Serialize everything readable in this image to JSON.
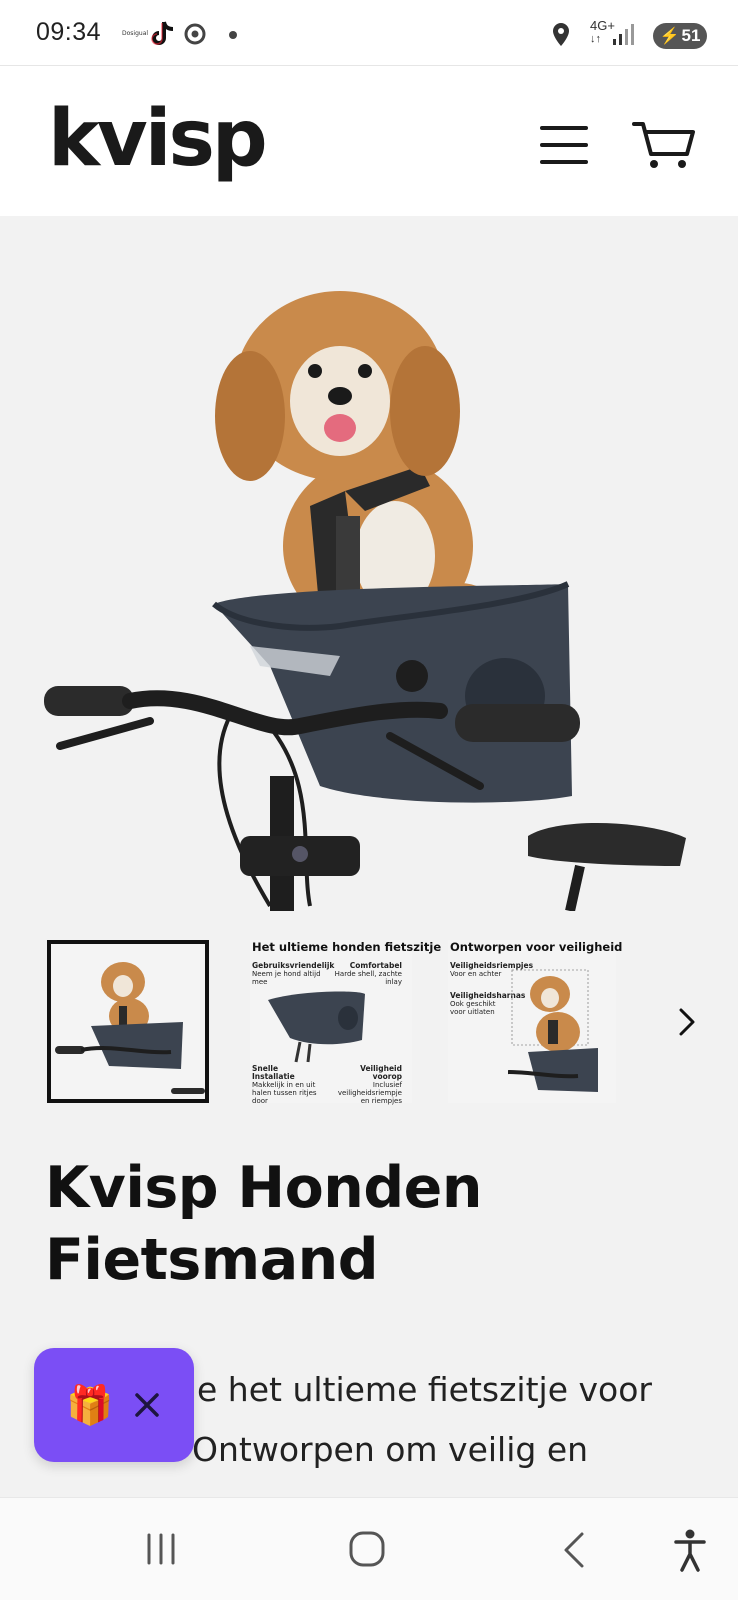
{
  "status_bar": {
    "time": "09:34",
    "tiny_label": "Dosigual",
    "network": "4G+",
    "battery": "51"
  },
  "header": {
    "logo": "kvisp",
    "menu_icon": "hamburger-menu-icon",
    "cart_icon": "shopping-cart-icon"
  },
  "gallery": {
    "thumbnails": [
      {
        "name": "product-photo"
      },
      {
        "title": "Het ultieme honden fietszitje",
        "features": [
          {
            "label": "Gebruiksvriendelijk",
            "text": "Neem je hond altijd mee"
          },
          {
            "label": "Comfortabel",
            "text": "Harde shell, zachte inlay"
          },
          {
            "label": "Snelle Installatie",
            "text": "Makkelijk in en uit halen tussen ritjes door"
          },
          {
            "label": "Veiligheid voorop",
            "text": "Inclusief veiligheidsriempje en riempjes"
          }
        ]
      },
      {
        "title": "Ontworpen voor veiligheid",
        "features": [
          {
            "label": "Veiligheidsriempjes",
            "text": "Voor en achter"
          },
          {
            "label": "Veiligheidsharnas",
            "text": "Ook geschikt voor uitlaten"
          }
        ]
      }
    ],
    "next_icon": "chevron-right-icon"
  },
  "product": {
    "title_line1": "Kvisp Honden",
    "title_line2": "Fietsmand",
    "desc_line1": "e het ultieme fietszitje voor",
    "desc_line2": "Ontworpen om veilig en"
  },
  "gift_widget": {
    "icon": "gift-icon",
    "close_icon": "close-icon"
  },
  "nav_bar": {
    "recents_icon": "recent-apps-icon",
    "home_icon": "home-icon",
    "back_icon": "back-icon",
    "accessibility_icon": "accessibility-icon"
  },
  "colors": {
    "accent": "#7b4ef5",
    "text": "#111111",
    "background": "#f2f2f2"
  }
}
